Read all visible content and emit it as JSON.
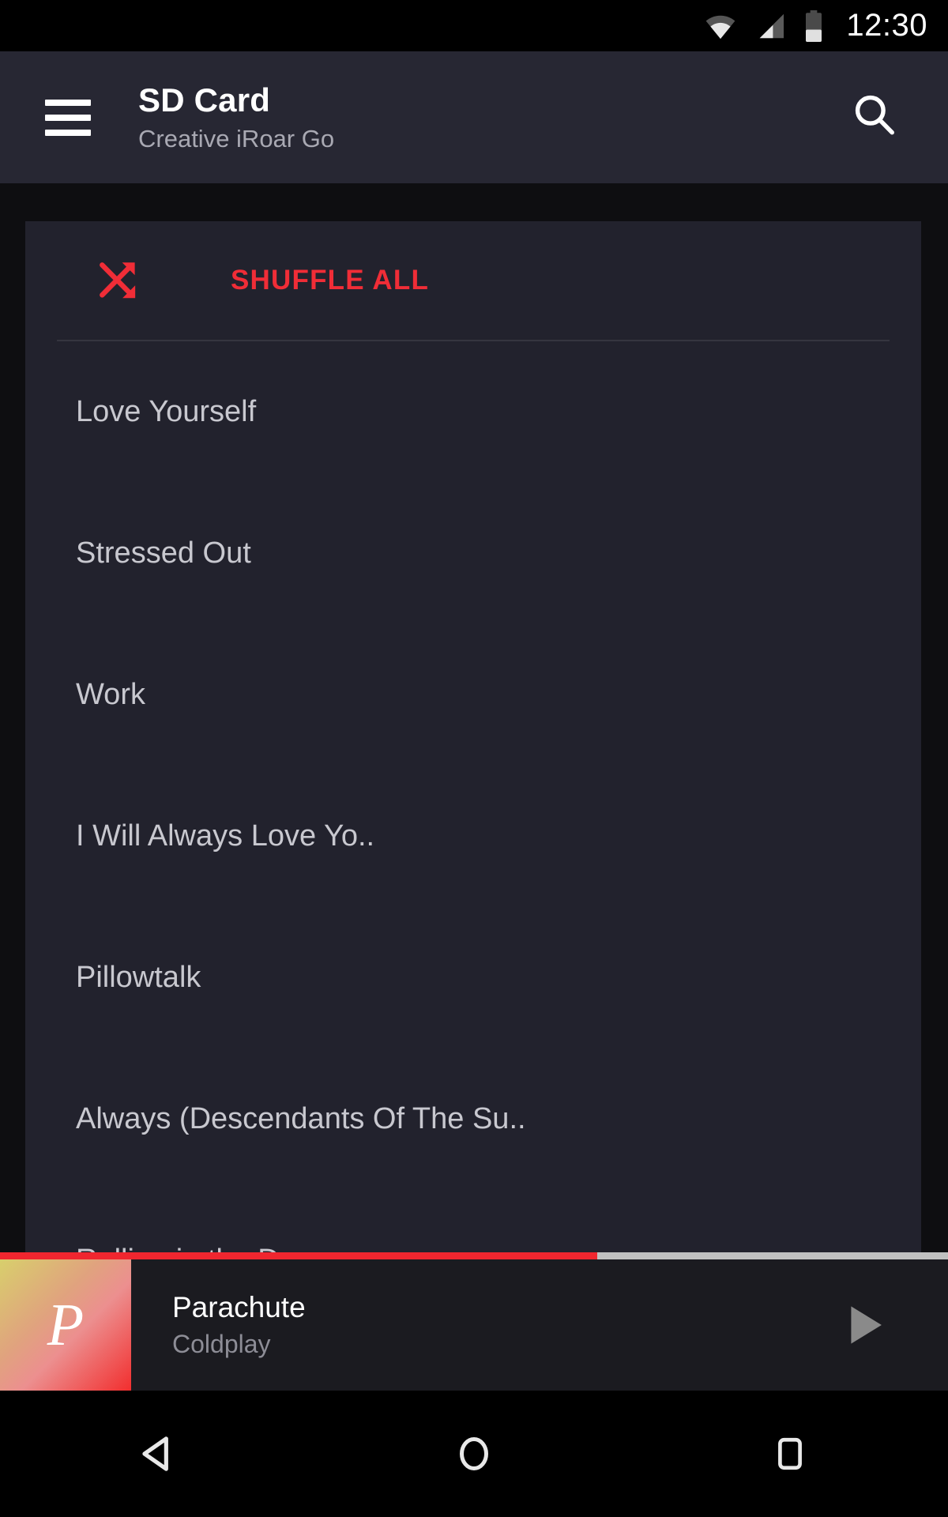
{
  "status_bar": {
    "time": "12:30",
    "icons": [
      "wifi-icon",
      "cellular-signal-icon",
      "battery-icon"
    ],
    "battery_level_percent": 40
  },
  "app_bar": {
    "menu_icon": "hamburger-menu-icon",
    "title": "SD Card",
    "subtitle": "Creative iRoar Go",
    "search_icon": "search-icon"
  },
  "shuffle": {
    "icon": "shuffle-icon",
    "label": "SHUFFLE ALL",
    "color": "#f02d37"
  },
  "song_list": [
    {
      "title": "Love Yourself"
    },
    {
      "title": "Stressed Out"
    },
    {
      "title": "Work"
    },
    {
      "title": "I Will Always Love Yo.."
    },
    {
      "title": "Pillowtalk"
    },
    {
      "title": "Always (Descendants Of The Su.."
    },
    {
      "title": "Rolling in the Deep"
    }
  ],
  "now_playing": {
    "album_art_letter": "P",
    "title": "Parachute",
    "artist": "Coldplay",
    "progress_percent": 63,
    "progress_color": "#f0262f",
    "track_color": "#c0c0c0",
    "play_icon": "play-icon"
  },
  "nav_bar": {
    "back_icon": "back-triangle-icon",
    "home_icon": "home-circle-icon",
    "recents_icon": "recents-square-icon"
  },
  "theme": {
    "page_background": "#0e0e11",
    "card_background": "#22222d",
    "app_bar_background": "#272733",
    "accent": "#f02d37"
  }
}
